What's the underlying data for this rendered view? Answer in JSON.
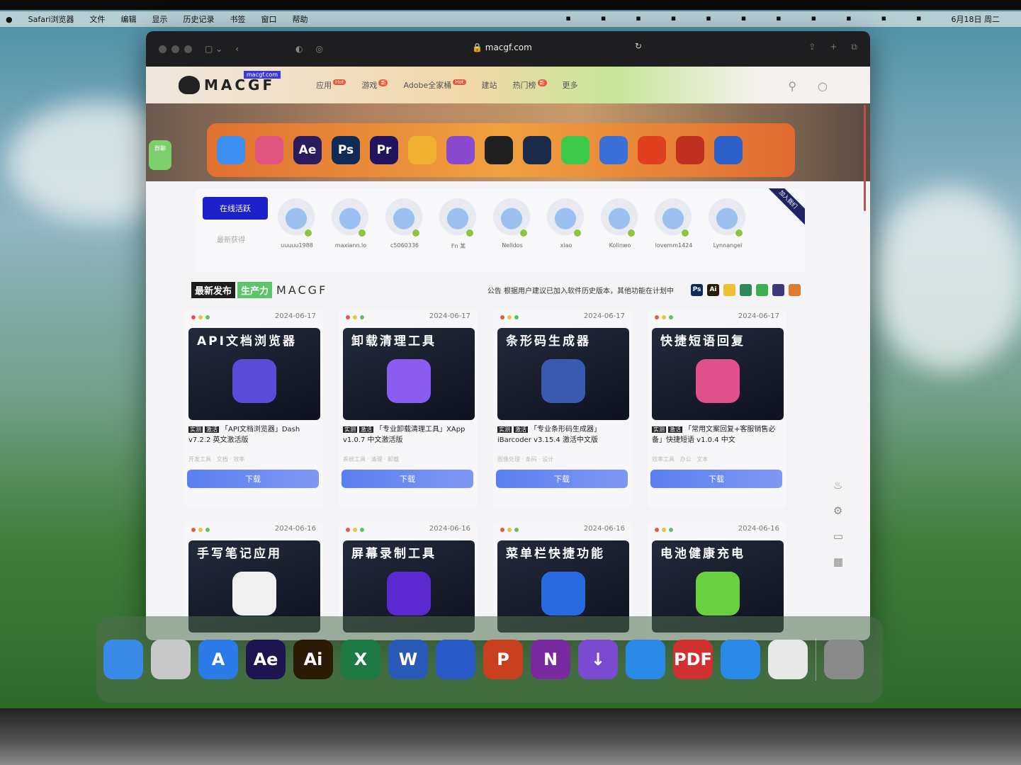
{
  "menubar": {
    "items": [
      "Safari浏览器",
      "文件",
      "编辑",
      "显示",
      "历史记录",
      "书签",
      "窗口",
      "帮助"
    ],
    "status_icons": [
      "messages-icon",
      "battery-app-icon",
      "yi-icon",
      "grid-icon",
      "shield-icon",
      "battery-icon",
      "s-icon",
      "star-icon",
      "wifi-icon",
      "search-icon",
      "control-center-icon"
    ],
    "datetime": "6月18日 周二"
  },
  "browser": {
    "url": "macgf.com"
  },
  "site": {
    "logo_text": "MACGF",
    "logo_tag": "macgf.com",
    "nav": [
      {
        "label": "应用",
        "badge": "Hot"
      },
      {
        "label": "游戏",
        "badge": "新"
      },
      {
        "label": "Adobe全家桶",
        "badge": "Hot"
      },
      {
        "label": "建站"
      },
      {
        "label": "热门榜",
        "badge": "新"
      },
      {
        "label": "更多"
      }
    ],
    "banner_apps": [
      {
        "label": "",
        "color": "#3b8ff0"
      },
      {
        "label": "",
        "color": "#e05580"
      },
      {
        "label": "Ae",
        "color": "#2a1a5e"
      },
      {
        "label": "Ps",
        "color": "#0f2a56"
      },
      {
        "label": "Pr",
        "color": "#22135e"
      },
      {
        "label": "",
        "color": "#f0b030"
      },
      {
        "label": "",
        "color": "#8a4ad0"
      },
      {
        "label": "",
        "color": "#202020"
      },
      {
        "label": "",
        "color": "#1b2a48"
      },
      {
        "label": "",
        "color": "#3cc848"
      },
      {
        "label": "",
        "color": "#3a70d8"
      },
      {
        "label": "",
        "color": "#e04020"
      },
      {
        "label": "",
        "color": "#c03020"
      },
      {
        "label": "",
        "color": "#2a60c8"
      }
    ],
    "side_pill": "群聊",
    "online": {
      "button": "在线活跃",
      "sub": "最新获得",
      "corner": "加入我们",
      "users": [
        "uuuuu1988",
        "maxiann.lo",
        "c5060336",
        "Fn 某",
        "Nelldos",
        "xiao",
        "Kolinwo",
        "lovemm1424",
        "Lynnangel"
      ]
    },
    "section": {
      "badge1": "最新发布",
      "badge2": "生产力",
      "brand": "MACGF",
      "notice": "公告  根据用户建议已加入软件历史版本，其他功能在计划中",
      "software_icons": [
        {
          "label": "Ps",
          "color": "#0f2a56"
        },
        {
          "label": "Ai",
          "color": "#2b1a05"
        },
        {
          "label": "",
          "color": "#f0c030"
        },
        {
          "label": "",
          "color": "#2a8a5a"
        },
        {
          "label": "",
          "color": "#3cb050"
        },
        {
          "label": "",
          "color": "#3a3a7a"
        },
        {
          "label": "",
          "color": "#e07a30"
        }
      ]
    },
    "cards": [
      {
        "date": "2024-06-17",
        "thumb_title": "API文档浏览器",
        "tags": [
          "实测",
          "激活"
        ],
        "desc": "「API文档浏览器」Dash v7.2.2 英文激活版",
        "meta": "开发工具 · 文档 · 效率",
        "download": "下载",
        "icon_color": "#5b4bd6"
      },
      {
        "date": "2024-06-17",
        "thumb_title": "卸载清理工具",
        "tags": [
          "实测",
          "激活"
        ],
        "desc": "「专业卸载清理工具」XApp v1.0.7 中文激活版",
        "meta": "系统工具 · 清理 · 卸载",
        "download": "下载",
        "icon_color": "#8a5cf0"
      },
      {
        "date": "2024-06-17",
        "thumb_title": "条形码生成器",
        "tags": [
          "实测",
          "激活"
        ],
        "desc": "「专业条形码生成器」iBarcoder v3.15.4 激活中文版",
        "meta": "图像处理 · 条码 · 设计",
        "download": "下载",
        "icon_color": "#3a5ab0"
      },
      {
        "date": "2024-06-17",
        "thumb_title": "快捷短语回复",
        "tags": [
          "实测",
          "激活"
        ],
        "desc": "「常用文案回复+客服销售必备」快捷短语 v1.0.4 中文",
        "meta": "效率工具 · 办公 · 文本",
        "download": "下载",
        "icon_color": "#e0508a"
      },
      {
        "date": "2024-06-16",
        "thumb_title": "手写笔记应用",
        "tags": [],
        "desc": "",
        "meta": "",
        "download": "",
        "icon_color": "#f0f0f0"
      },
      {
        "date": "2024-06-16",
        "thumb_title": "屏幕录制工具",
        "tags": [],
        "desc": "",
        "meta": "",
        "download": "",
        "icon_color": "#5a2ad0"
      },
      {
        "date": "2024-06-16",
        "thumb_title": "菜单栏快捷功能",
        "tags": [],
        "desc": "",
        "meta": "",
        "download": "",
        "icon_color": "#2a6ae0"
      },
      {
        "date": "2024-06-16",
        "thumb_title": "电池健康充电",
        "tags": [],
        "desc": "",
        "meta": "",
        "download": "",
        "icon_color": "#6ad040"
      }
    ]
  },
  "dock": [
    {
      "name": "finder",
      "label": "",
      "color": "#3a8ae8"
    },
    {
      "name": "launchpad",
      "label": "",
      "color": "#c8c8c8"
    },
    {
      "name": "app-store",
      "label": "A",
      "color": "#2a7ae8"
    },
    {
      "name": "after-effects",
      "label": "Ae",
      "color": "#1e1550"
    },
    {
      "name": "illustrator",
      "label": "Ai",
      "color": "#2b1a05"
    },
    {
      "name": "excel",
      "label": "X",
      "color": "#1d7a44"
    },
    {
      "name": "word",
      "label": "W",
      "color": "#2a5ab8"
    },
    {
      "name": "remote-desktop",
      "label": "",
      "color": "#2a5ac8"
    },
    {
      "name": "powerpoint",
      "label": "P",
      "color": "#c8401f"
    },
    {
      "name": "onenote",
      "label": "N",
      "color": "#7a2aa0"
    },
    {
      "name": "downie",
      "label": "↓",
      "color": "#7a4ad0"
    },
    {
      "name": "safari",
      "label": "",
      "color": "#2a8ae8"
    },
    {
      "name": "pdf-expert",
      "label": "PDF",
      "color": "#d03030"
    },
    {
      "name": "mountain-app",
      "label": "",
      "color": "#2a8ae8"
    },
    {
      "name": "chrome",
      "label": "",
      "color": "#e8e8e8"
    },
    {
      "name": "trash",
      "label": "",
      "color": "#8a8a8a"
    }
  ]
}
